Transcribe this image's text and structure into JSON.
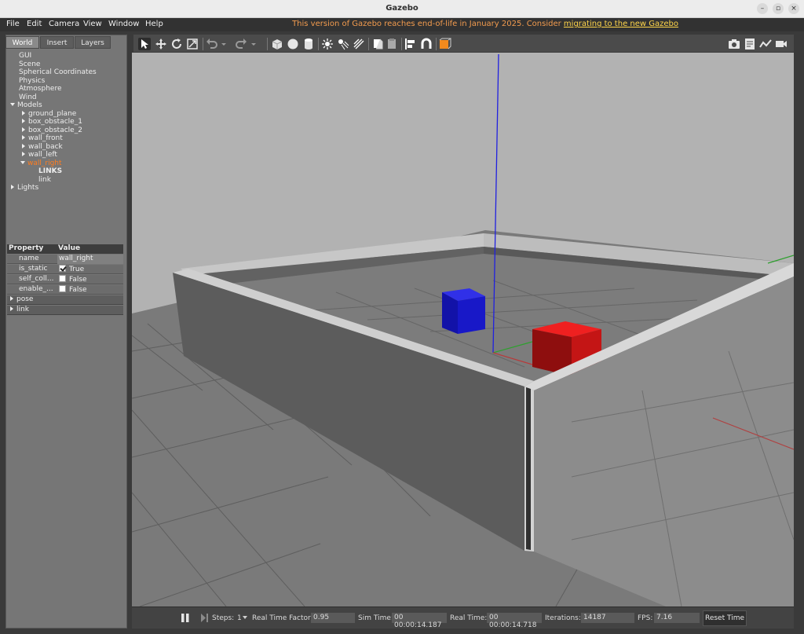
{
  "window": {
    "title": "Gazebo"
  },
  "menu": [
    "File",
    "Edit",
    "Camera",
    "View",
    "Window",
    "Help"
  ],
  "notice": {
    "text": "This version of Gazebo reaches end-of-life in January 2025. Consider ",
    "link": "migrating to the new Gazebo"
  },
  "tabs": [
    "World",
    "Insert",
    "Layers"
  ],
  "tree": {
    "gui": "GUI",
    "scene": "Scene",
    "spherical": "Spherical Coordinates",
    "physics": "Physics",
    "atmosphere": "Atmosphere",
    "wind": "Wind",
    "models": "Models",
    "model_items": [
      "ground_plane",
      "box_obstacle_1",
      "box_obstacle_2",
      "wall_front",
      "wall_back",
      "wall_left"
    ],
    "selected": "wall_right",
    "links_header": "LINKS",
    "link": "link",
    "lights": "Lights"
  },
  "properties": {
    "col_property": "Property",
    "col_value": "Value",
    "name_label": "name",
    "name_value": "wall_right",
    "is_static_label": "is_static",
    "is_static_value": "True",
    "self_coll_label": "self_coll...",
    "self_coll_value": "False",
    "enable_label": "enable_...",
    "enable_value": "False",
    "pose_label": "pose",
    "link_label": "link"
  },
  "bottom": {
    "steps_label": "Steps:",
    "steps_value": "1",
    "rtf_label": "Real Time Factor:",
    "rtf_value": "0.95",
    "sim_label": "Sim Time:",
    "sim_value": "00 00:00:14.187",
    "real_label": "Real Time:",
    "real_value": "00 00:00:14.718",
    "iter_label": "Iterations:",
    "iter_value": "14187",
    "fps_label": "FPS:",
    "fps_value": "7.16",
    "reset_label": "Reset Time"
  },
  "colors": {
    "accent_notice": "#f29b4e",
    "selected_item": "#ff7d1f",
    "box_blue": "#1515c8",
    "box_red": "#d51515"
  },
  "toolbar_icons": [
    "select-arrow-icon",
    "translate-icon",
    "rotate-icon",
    "scale-icon",
    "undo-icon",
    "redo-icon",
    "box-shape-icon",
    "sphere-shape-icon",
    "cylinder-shape-icon",
    "point-light-icon",
    "spot-light-icon",
    "directional-light-icon",
    "copy-icon",
    "paste-icon",
    "align-icon",
    "snap-icon",
    "view-angle-icon",
    "screenshot-icon",
    "log-icon",
    "plot-icon",
    "video-icon"
  ]
}
